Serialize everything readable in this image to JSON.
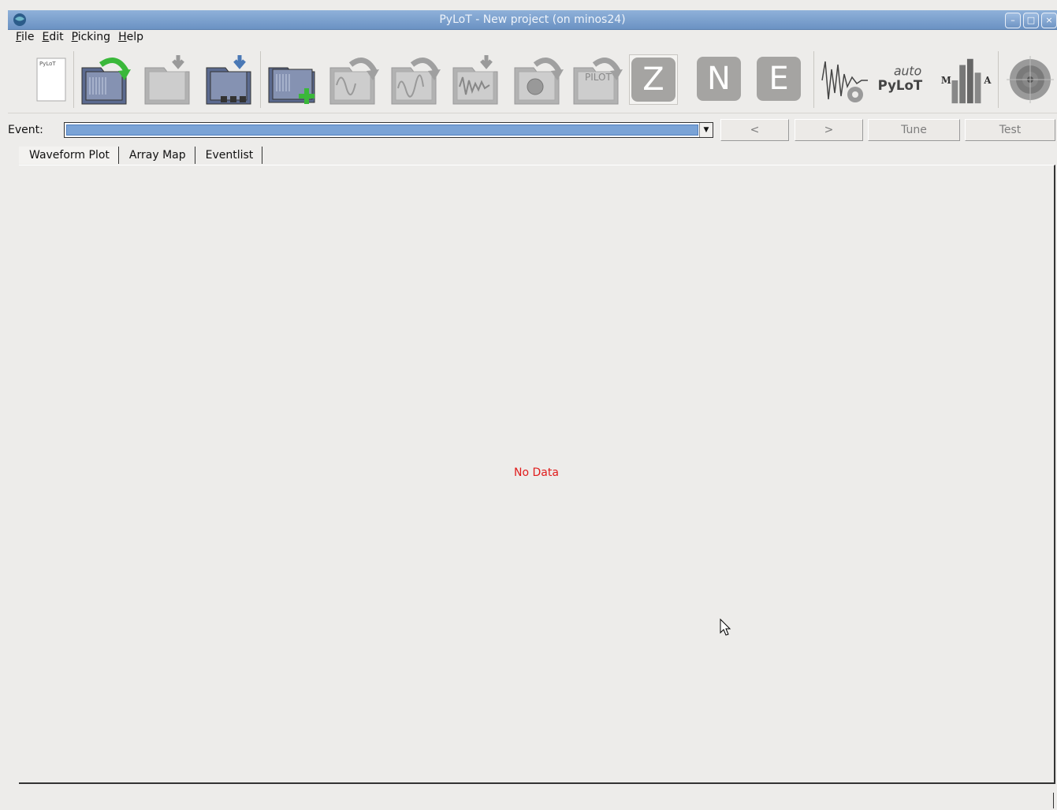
{
  "window": {
    "title": "PyLoT - New project  (on minos24)"
  },
  "menu": [
    {
      "mnemonic": "F",
      "rest": "ile"
    },
    {
      "mnemonic": "E",
      "rest": "dit"
    },
    {
      "mnemonic": "P",
      "rest": "icking"
    },
    {
      "mnemonic": "H",
      "rest": "elp"
    }
  ],
  "toolbar": {
    "new_project_icon_text": "PyLoT",
    "components": {
      "z": "Z",
      "n": "N",
      "e": "E"
    },
    "autopylot": {
      "line1": "auto",
      "line2": "PyLoT"
    },
    "manual_auto": {
      "m": "M",
      "a": "A"
    },
    "pilot_icon_text": "PILOT",
    "icons": [
      "new-project-icon",
      "open-project-icon",
      "save-project-icon",
      "save-project-as-icon",
      "add-event-data-icon",
      "load-reference-picks-icon",
      "load-auto-picks-icon",
      "load-waveforms-icon",
      "load-location-icon",
      "load-pilot-icon",
      "z-component-icon",
      "n-component-icon",
      "e-component-icon",
      "tune-autopicker-icon",
      "autopylot-icon",
      "compare-picks-icon",
      "locate-event-icon"
    ]
  },
  "event": {
    "label": "Event:",
    "prev_label": "<",
    "next_label": ">",
    "tune_label": "Tune",
    "test_label": "Test"
  },
  "tabs": [
    "Waveform Plot",
    "Array Map",
    "Eventlist"
  ],
  "main": {
    "empty_message": "No Data"
  },
  "colors": {
    "no_data": "#e01b1b",
    "titlebar": "#7ba0cd",
    "accent_arrow": "#3ab83a"
  }
}
